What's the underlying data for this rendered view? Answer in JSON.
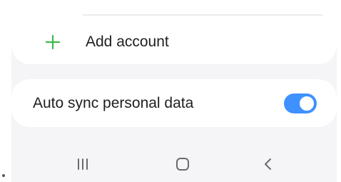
{
  "account_card": {
    "add_account_label": "Add account",
    "add_icon": "plus-icon",
    "add_icon_color": "#3dba4e"
  },
  "sync_card": {
    "label": "Auto sync personal data",
    "toggle_state": "on",
    "toggle_color": "#3e91ff"
  },
  "navigation_bar": {
    "buttons": [
      {
        "icon": "recents-icon"
      },
      {
        "icon": "home-icon"
      },
      {
        "icon": "back-icon"
      }
    ]
  },
  "colors": {
    "background": "#f5f5f7",
    "card": "#ffffff",
    "text": "#1f1f1f"
  }
}
